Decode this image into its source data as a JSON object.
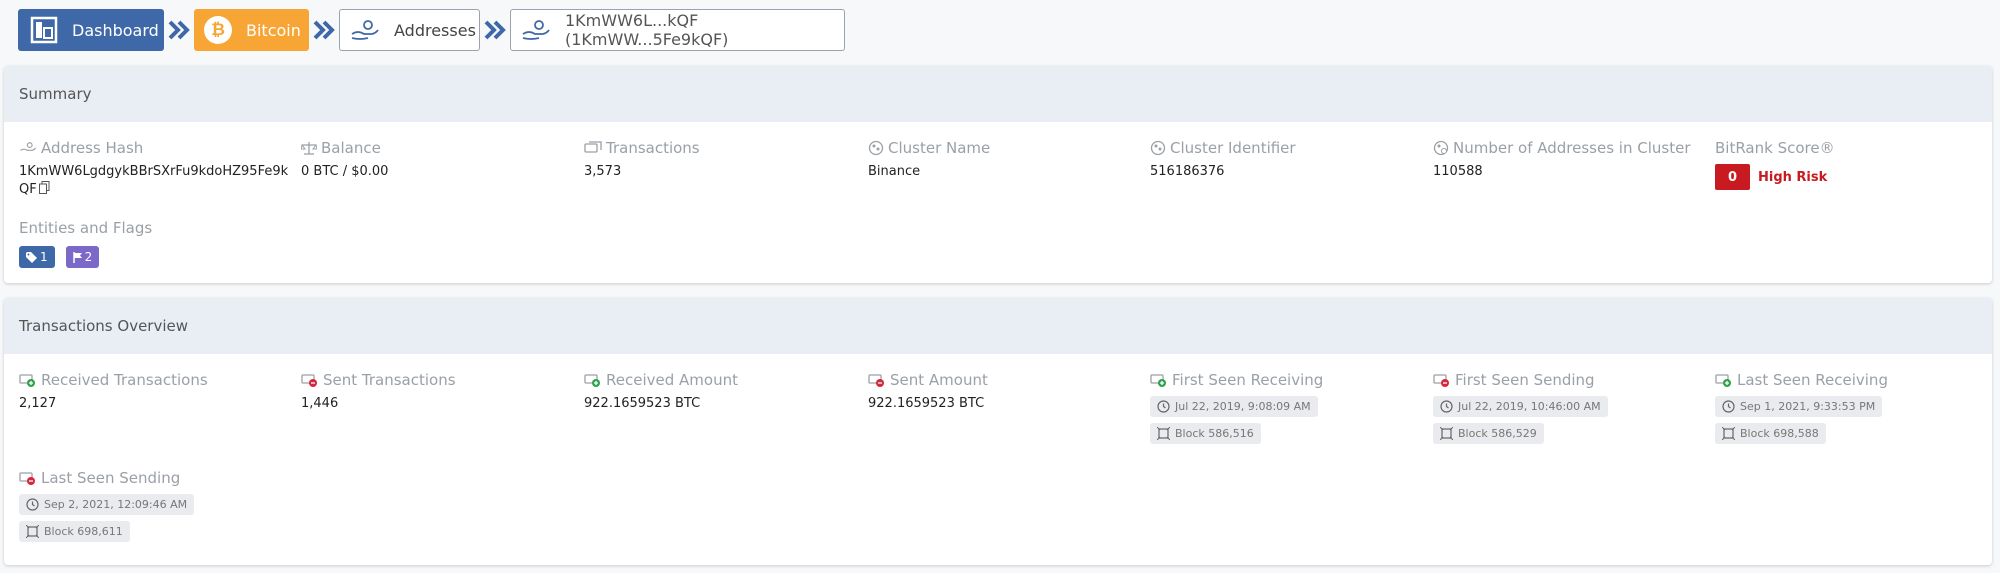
{
  "breadcrumb": {
    "dashboard": "Dashboard",
    "bitcoin": "Bitcoin",
    "addresses": "Addresses",
    "current": "1KmWW6L...kQF (1KmWW...5Fe9kQF)"
  },
  "summary": {
    "title": "Summary",
    "address_hash_label": "Address Hash",
    "address_hash": "1KmWW6LgdgykBBrSXrFu9kdoHZ95Fe9kQF",
    "balance_label": "Balance",
    "balance": "0 BTC / $0.00",
    "transactions_label": "Transactions",
    "transactions": "3,573",
    "cluster_name_label": "Cluster Name",
    "cluster_name": "Binance",
    "cluster_id_label": "Cluster Identifier",
    "cluster_id": "516186376",
    "num_addresses_label": "Number of Addresses in Cluster",
    "num_addresses": "110588",
    "bitrank_label": "BitRank Score®",
    "bitrank_score": "0",
    "bitrank_risk": "High Risk",
    "entities_label": "Entities and Flags",
    "entities_count": "1",
    "flags_count": "2"
  },
  "overview": {
    "title": "Transactions Overview",
    "received_tx_label": "Received Transactions",
    "received_tx": "2,127",
    "sent_tx_label": "Sent Transactions",
    "sent_tx": "1,446",
    "received_amount_label": "Received Amount",
    "received_amount": "922.1659523 BTC",
    "sent_amount_label": "Sent Amount",
    "sent_amount": "922.1659523 BTC",
    "first_recv_label": "First Seen Receiving",
    "first_recv_time": "Jul 22, 2019, 9:08:09 AM",
    "first_recv_block": "Block 586,516",
    "first_send_label": "First Seen Sending",
    "first_send_time": "Jul 22, 2019, 10:46:00 AM",
    "first_send_block": "Block 586,529",
    "last_recv_label": "Last Seen Receiving",
    "last_recv_time": "Sep 1, 2021, 9:33:53 PM",
    "last_recv_block": "Block 698,588",
    "last_send_label": "Last Seen Sending",
    "last_send_time": "Sep 2, 2021, 12:09:46 AM",
    "last_send_block": "Block 698,611"
  },
  "colors": {
    "primary": "#3f68a8",
    "bitcoin": "#f7a535",
    "risk": "#c81b21",
    "flag": "#7b68c8"
  }
}
